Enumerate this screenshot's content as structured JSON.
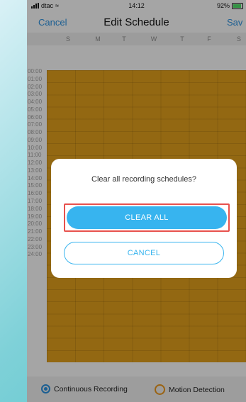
{
  "status_bar": {
    "carrier": "dtac",
    "time": "14:12",
    "battery": "92%"
  },
  "nav": {
    "cancel": "Cancel",
    "title": "Edit Schedule",
    "save": "Sav"
  },
  "days": [
    "S",
    "M",
    "T",
    "W",
    "T",
    "F",
    "S"
  ],
  "hours": [
    "00:00",
    "01:00",
    "02:00",
    "03:00",
    "04:00",
    "05:00",
    "06:00",
    "07:00",
    "08:00",
    "09:00",
    "10:00",
    "11:00",
    "12:00",
    "13:00",
    "14:00",
    "15:00",
    "16:00",
    "17:00",
    "18:00",
    "19:00",
    "20:00",
    "21:00",
    "22:00",
    "23:00",
    "24:00"
  ],
  "dialog": {
    "message": "Clear all recording schedules?",
    "confirm": "CLEAR ALL",
    "cancel": "CANCEL"
  },
  "legend": {
    "continuous": "Continuous Recording",
    "motion": "Motion Detection"
  },
  "colors": {
    "accent": "#37b4ef",
    "schedule": "#d99a1b",
    "highlight": "#e8514d"
  }
}
